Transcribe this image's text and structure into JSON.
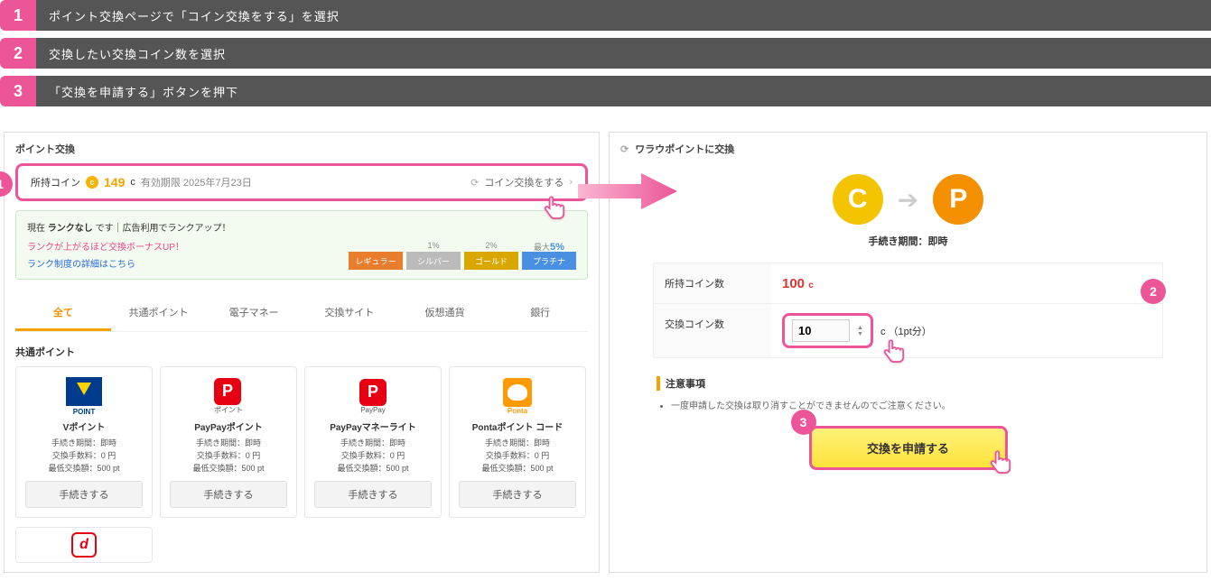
{
  "steps": [
    {
      "num": "1",
      "text": "ポイント交換ページで「コイン交換をする」を選択"
    },
    {
      "num": "2",
      "text": "交換したい交換コイン数を選択"
    },
    {
      "num": "3",
      "text": "「交換を申請する」ボタンを押下"
    }
  ],
  "left": {
    "title": "ポイント交換",
    "balance": {
      "label": "所持コイン",
      "amount": "149",
      "unit": "c",
      "expiry": "有効期限 2025年7月23日",
      "action": "コイン交換をする"
    },
    "rank": {
      "title_pre": "現在",
      "title_bold": "ランクなし",
      "title_post": "です｜広告利用でランクアップ！",
      "line1": "ランクが上がるほど交換ボーナスUP！",
      "line2": "ランク制度の詳細はこちら",
      "seg_regular": "レギュラー",
      "seg_silver": "シルバー",
      "seg_gold": "ゴールド",
      "seg_platinum": "プラチナ",
      "pct_silver": "1%",
      "pct_gold": "2%",
      "pct_plat_pre": "最大",
      "pct_plat": "5%"
    },
    "tabs": [
      "全て",
      "共通ポイント",
      "電子マネー",
      "交換サイト",
      "仮想通貨",
      "銀行"
    ],
    "section_title": "共通ポイント",
    "cards": [
      {
        "name": "Vポイント",
        "sub": "POINT",
        "period": "手続き期間：即時",
        "fee": "交換手数料：0 円",
        "min": "最低交換額：500 pt",
        "btn": "手続きする",
        "logo": "v"
      },
      {
        "name": "PayPayポイント",
        "sub": "ポイント",
        "period": "手続き期間：即時",
        "fee": "交換手数料：0 円",
        "min": "最低交換額：500 pt",
        "btn": "手続きする",
        "logo": "pp"
      },
      {
        "name": "PayPayマネーライト",
        "sub": "PayPay",
        "period": "手続き期間：即時",
        "fee": "交換手数料：0 円",
        "min": "最低交換額：500 pt",
        "btn": "手続きする",
        "logo": "pp"
      },
      {
        "name": "Pontaポイント コード",
        "sub": "Ponta",
        "period": "手続き期間：即時",
        "fee": "交換手数料：0 円",
        "min": "最低交換額：500 pt",
        "btn": "手続きする",
        "logo": "ponta"
      }
    ]
  },
  "right": {
    "title": "ワラウポイントに交換",
    "proc_time": "手続き期間：即時",
    "row1_label": "所持コイン数",
    "row1_value": "100",
    "row1_unit": "c",
    "row2_label": "交換コイン数",
    "stepper_value": "10",
    "stepper_suffix": "c （1pt分）",
    "notice_title": "注意事項",
    "notice_item": "一度申請した交換は取り消すことができませんのでご注意ください。",
    "apply": "交換を申請する"
  },
  "badges": {
    "b1": "1",
    "b2": "2",
    "b3": "3"
  }
}
